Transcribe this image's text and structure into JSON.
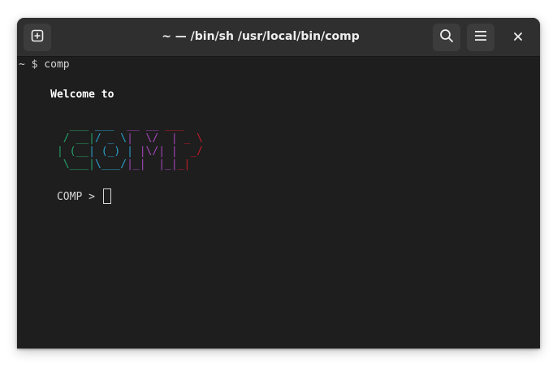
{
  "window": {
    "title": "~ — /bin/sh /usr/local/bin/comp"
  },
  "headerbar": {
    "new_tab_icon": "new-tab-icon",
    "search_icon": "search-icon",
    "menu_icon": "hamburger-menu-icon",
    "close_icon": "close-icon"
  },
  "terminal": {
    "command_line": "~ $ comp",
    "welcome": "     Welcome to",
    "art": [
      {
        "green": "  ___",
        "cyan": " ___ ",
        "purple": " __ __",
        "red": " ___ "
      },
      {
        "green": " / __|",
        "cyan": "/ _ \\",
        "purple": "|  \\/  |",
        "red": " _ \\"
      },
      {
        "green": "| (__",
        "cyan": "| (_) |",
        "purple": " |\\/| |",
        "red": "  _/"
      },
      {
        "green": " \\___|",
        "cyan": "\\___/",
        "purple": "|_|  |_|",
        "red": "_|  "
      }
    ],
    "prompt": "COMP > "
  },
  "colors": {
    "green": "#26a269",
    "cyan": "#2a9fc9",
    "purple": "#a347ba",
    "red": "#c01c28"
  }
}
